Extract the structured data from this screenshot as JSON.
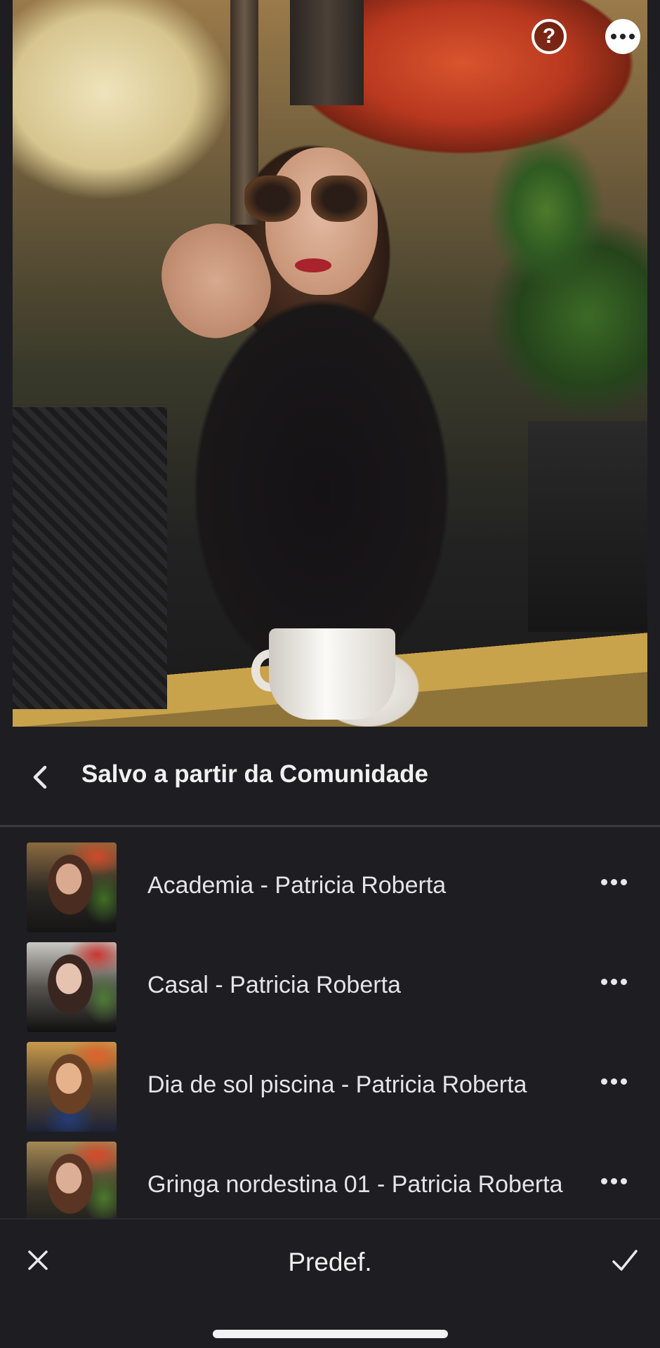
{
  "photo": {
    "alt": "Editing preview photo",
    "help_icon": "question-mark-circle-icon",
    "more_icon": "more-dots-icon",
    "help_glyph": "?"
  },
  "panel": {
    "back_icon": "chevron-left-icon",
    "title": "Salvo a partir da Comunidade"
  },
  "presets": [
    {
      "name": "Academia - Patricia Roberta"
    },
    {
      "name": "Casal - Patricia Roberta"
    },
    {
      "name": "Dia de sol piscina - Patricia Roberta"
    },
    {
      "name": "Gringa nordestina 01 - Patricia Roberta"
    }
  ],
  "bottom_bar": {
    "cancel_icon": "close-icon",
    "title": "Predef.",
    "confirm_icon": "checkmark-icon"
  },
  "colors": {
    "background": "#1e1e22",
    "text": "#e9e9ec",
    "divider": "#3a3a3f"
  }
}
